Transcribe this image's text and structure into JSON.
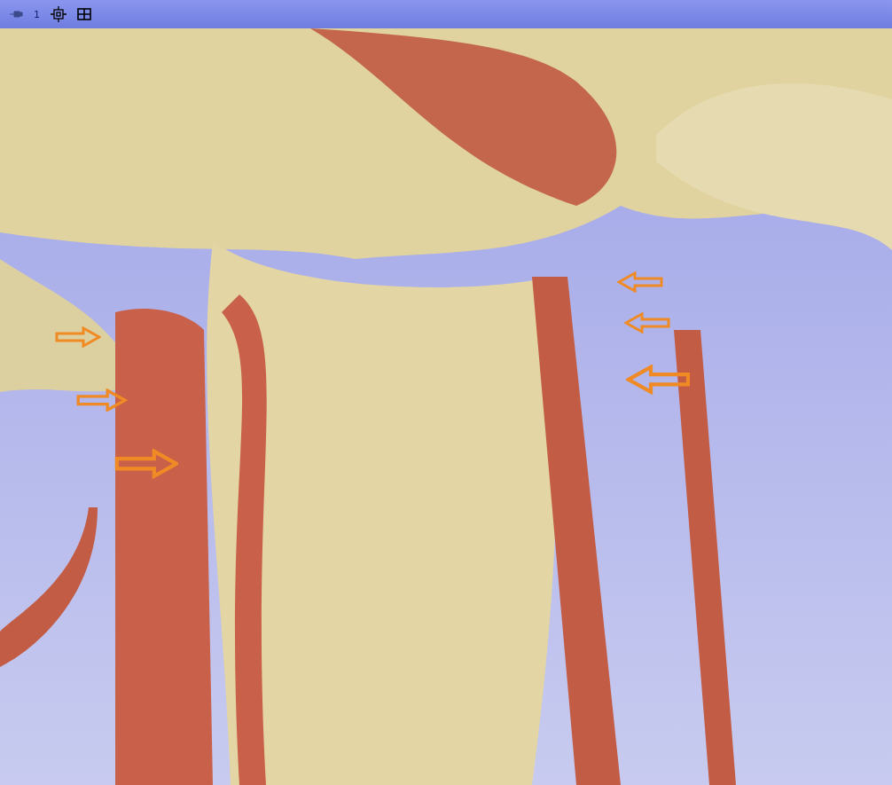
{
  "toolbar": {
    "view_label": "1"
  }
}
